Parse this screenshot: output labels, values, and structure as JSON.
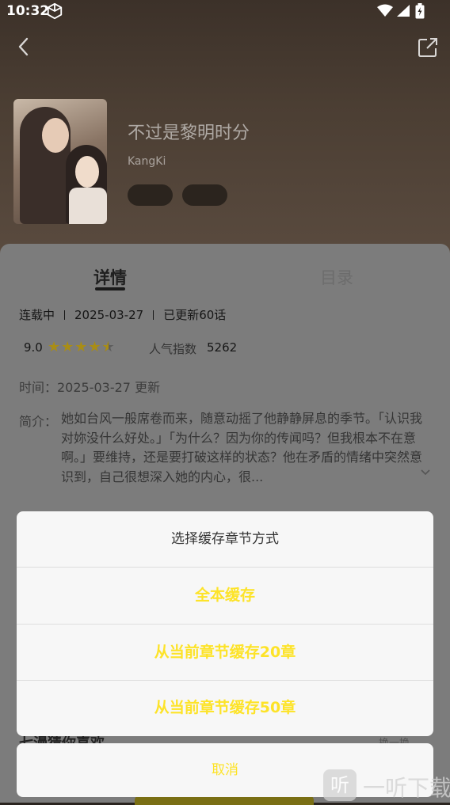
{
  "status_bar": {
    "time": "10:32"
  },
  "book": {
    "title": "不过是黎明时分",
    "author": "KangKi"
  },
  "tabs": [
    {
      "label": "详情",
      "active": true
    },
    {
      "label": "目录",
      "active": false
    }
  ],
  "meta": {
    "status": "连载中",
    "date": "2025-03-27",
    "updated": "已更新60话"
  },
  "rating": {
    "score": "9.0",
    "stars": 4.5,
    "popularity_label": "人气指数",
    "popularity_value": "5262"
  },
  "update_time": "时间：2025-03-27 更新",
  "intro": {
    "label": "简介：",
    "text": "她如台风一般席卷而来，随意动摇了他静静屏息的季节。「认识我对妳没什么好处。」「为什么？因为你的传闻吗？但我根本不在意啊。」要维持，还是要打破这样的状态？他在矛盾的情绪中突然意识到，自己很想深入她的内心，很..."
  },
  "dialog": {
    "title": "选择缓存章节方式",
    "options": [
      "全本缓存",
      "从当前章节缓存20章",
      "从当前章节缓存50章"
    ],
    "cancel": "取消"
  },
  "behind": {
    "section_title": "七漫猜你喜欢",
    "right_action": "换一换"
  },
  "watermark": {
    "icon_text": "听",
    "text": "一听下载"
  },
  "colors": {
    "accent": "#fde328",
    "star": "#a98d16",
    "overlay": "#7c7c7c"
  }
}
